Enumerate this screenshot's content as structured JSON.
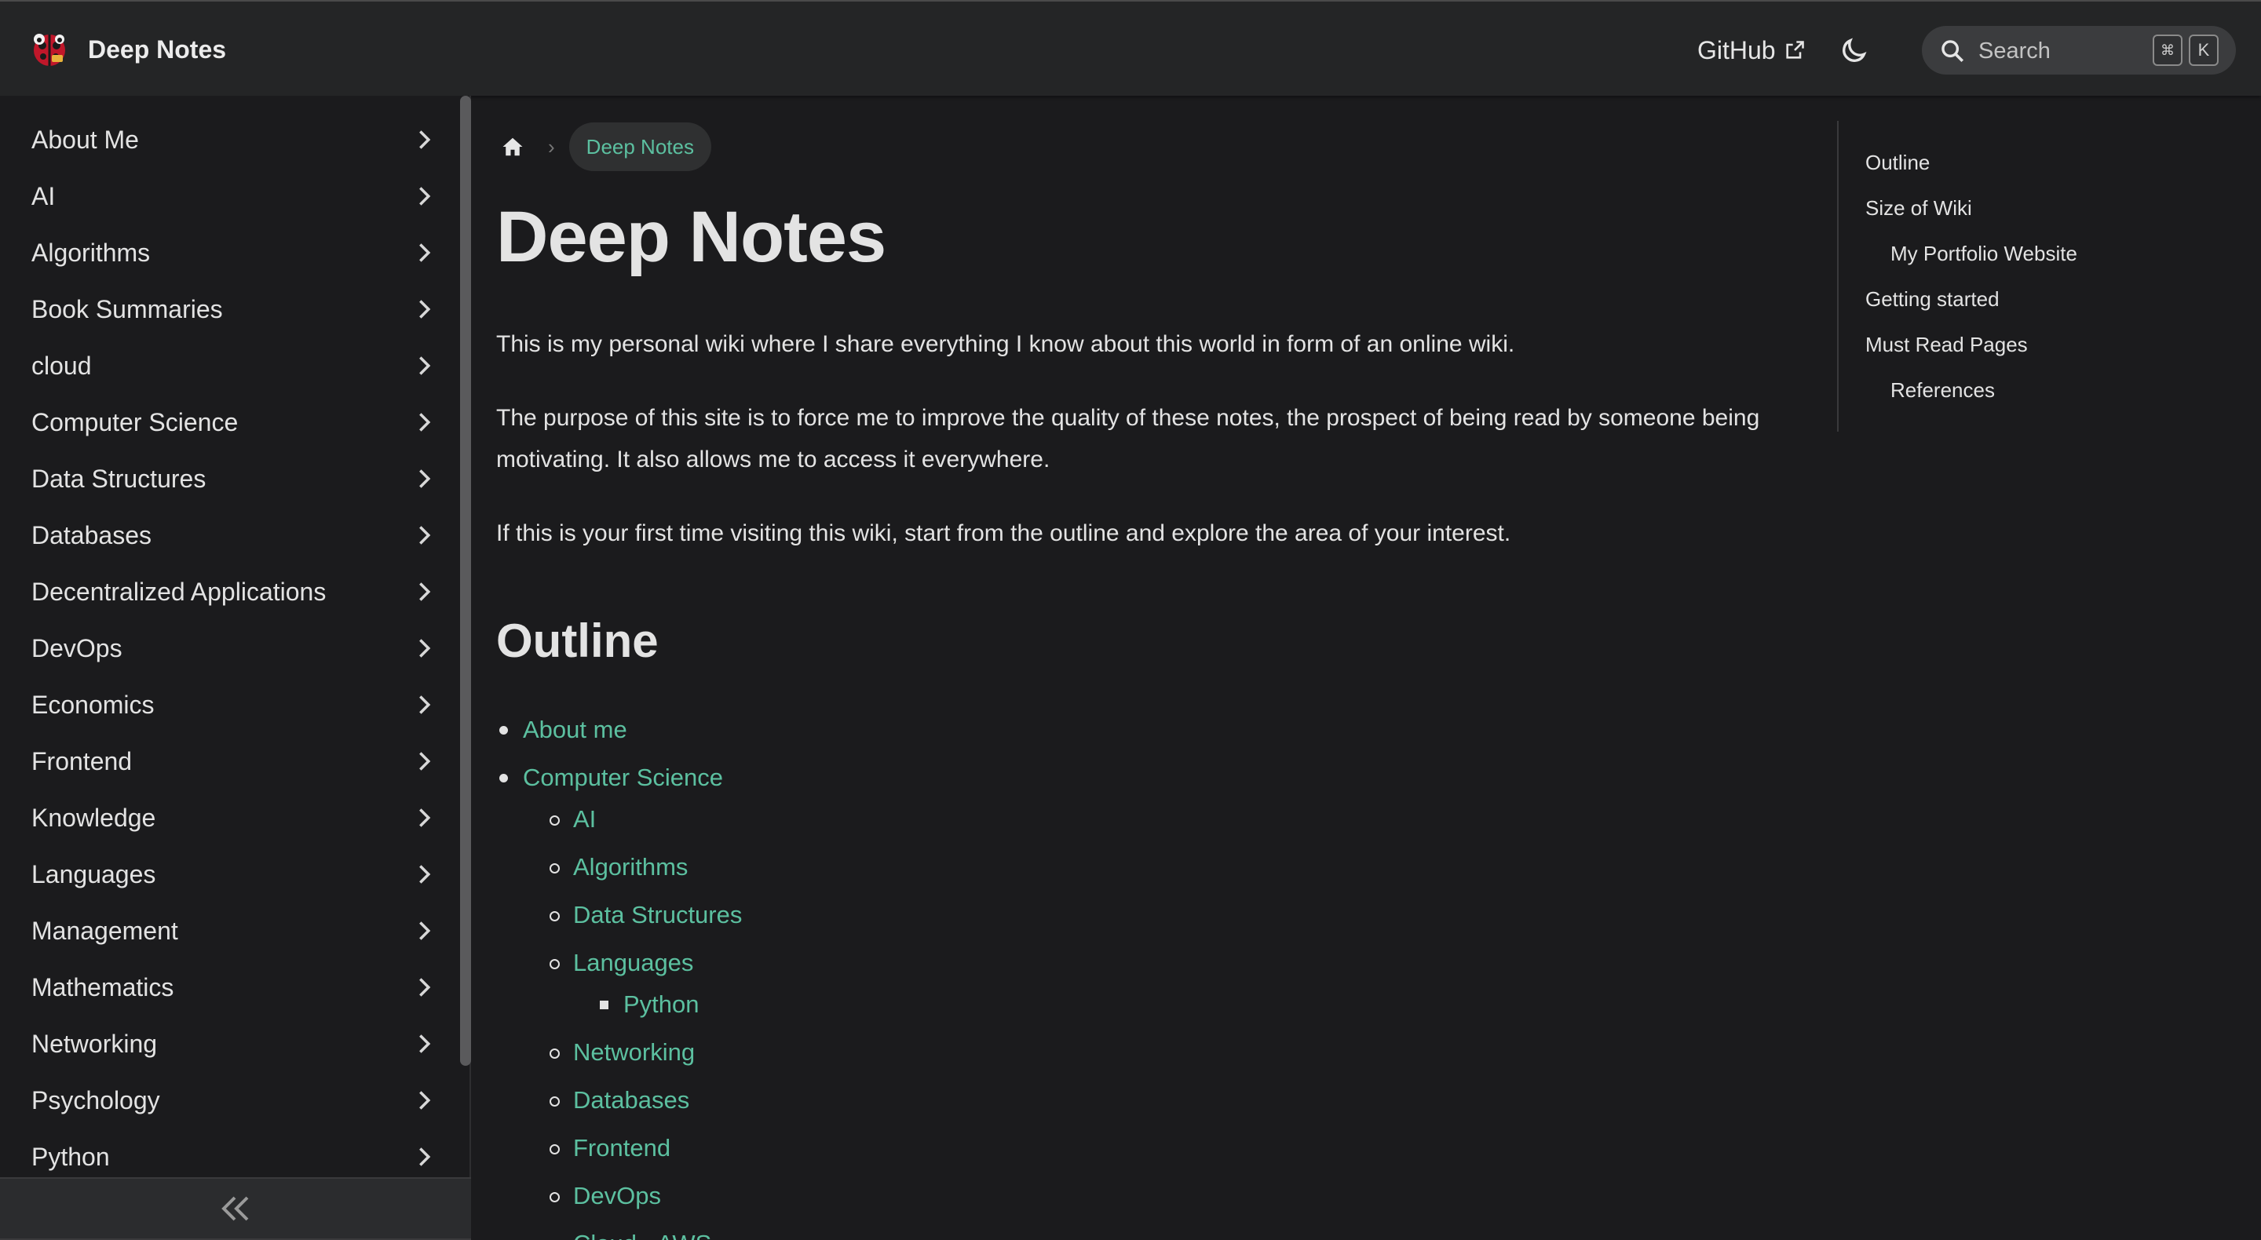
{
  "navbar": {
    "brand_title": "Deep Notes",
    "github_label": "GitHub",
    "search_placeholder": "Search",
    "kbd_cmd": "⌘",
    "kbd_k": "K"
  },
  "sidebar": {
    "items": [
      {
        "label": "About Me"
      },
      {
        "label": "AI"
      },
      {
        "label": "Algorithms"
      },
      {
        "label": "Book Summaries"
      },
      {
        "label": "cloud"
      },
      {
        "label": "Computer Science"
      },
      {
        "label": "Data Structures"
      },
      {
        "label": "Databases"
      },
      {
        "label": "Decentralized Applications"
      },
      {
        "label": "DevOps"
      },
      {
        "label": "Economics"
      },
      {
        "label": "Frontend"
      },
      {
        "label": "Knowledge"
      },
      {
        "label": "Languages"
      },
      {
        "label": "Management"
      },
      {
        "label": "Mathematics"
      },
      {
        "label": "Networking"
      },
      {
        "label": "Psychology"
      },
      {
        "label": "Python"
      }
    ]
  },
  "breadcrumb": {
    "current": "Deep Notes"
  },
  "main": {
    "title": "Deep Notes",
    "paragraphs": [
      "This is my personal wiki where I share everything I know about this world in form of an online wiki.",
      "The purpose of this site is to force me to improve the quality of these notes, the prospect of being read by someone being motivating. It also allows me to access it everywhere.",
      "If this is your first time visiting this wiki, start from the outline and explore the area of your interest."
    ],
    "outline_heading": "Outline",
    "outline": [
      {
        "label": "About me",
        "level": 1
      },
      {
        "label": "Computer Science",
        "level": 1
      },
      {
        "label": "AI",
        "level": 2
      },
      {
        "label": "Algorithms",
        "level": 2
      },
      {
        "label": "Data Structures",
        "level": 2
      },
      {
        "label": "Languages",
        "level": 2
      },
      {
        "label": "Python",
        "level": 3
      },
      {
        "label": "Networking",
        "level": 2
      },
      {
        "label": "Databases",
        "level": 2
      },
      {
        "label": "Frontend",
        "level": 2
      },
      {
        "label": "DevOps",
        "level": 2
      },
      {
        "label": "Cloud - AWS",
        "level": 2
      }
    ]
  },
  "toc": {
    "items": [
      {
        "label": "Outline",
        "level": 1
      },
      {
        "label": "Size of Wiki",
        "level": 1
      },
      {
        "label": "My Portfolio Website",
        "level": 2
      },
      {
        "label": "Getting started",
        "level": 1
      },
      {
        "label": "Must Read Pages",
        "level": 1
      },
      {
        "label": "References",
        "level": 2
      }
    ]
  },
  "colors": {
    "background": "#1b1b1d",
    "navbar": "#242526",
    "link": "#5cc0a0",
    "text": "#e3e3e3"
  }
}
